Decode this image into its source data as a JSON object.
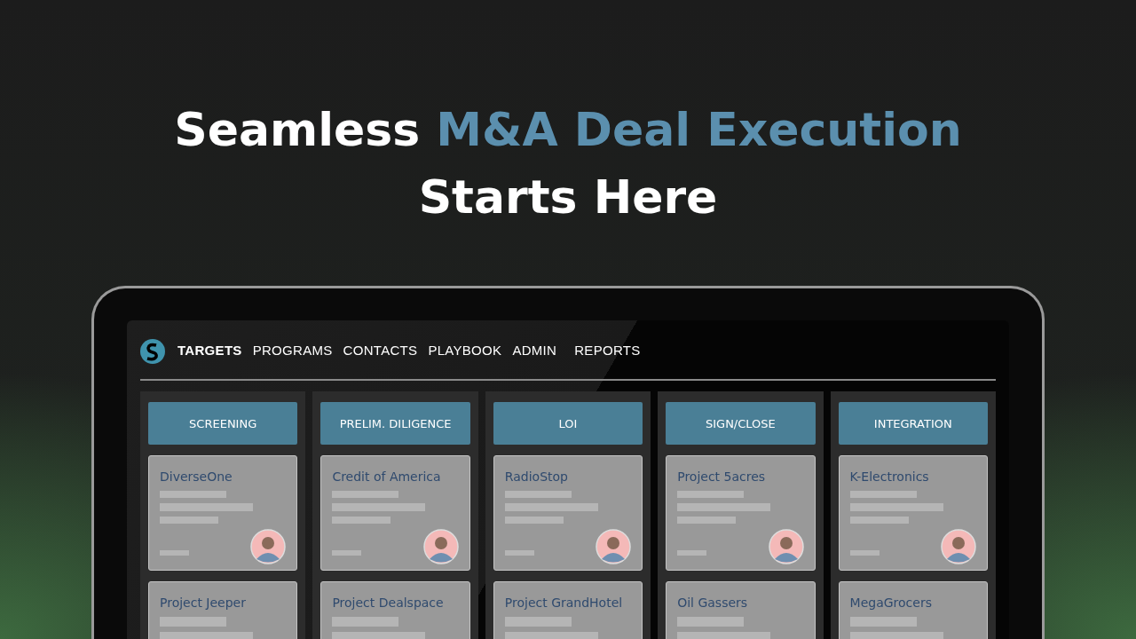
{
  "headline": {
    "line_1": [
      {
        "text": "Seamless ",
        "highlighted": false
      },
      {
        "text": "M&A Deal Execution",
        "highlighted": true
      }
    ],
    "line_2": "Starts Here"
  },
  "nav": [
    {
      "label": "TARGETS",
      "selected": true
    },
    {
      "label": "PROGRAMS",
      "selected": false
    },
    {
      "label": "CONTACTS",
      "selected": false
    },
    {
      "label": "PLAYBOOK",
      "selected": false
    },
    {
      "label": "ADMIN",
      "selected": false
    },
    {
      "label": "REPORTS",
      "selected": false
    }
  ],
  "columns": [
    {
      "title": "SCREENING",
      "cards": [
        {
          "name": "DiverseOne",
          "has_avatar": true
        },
        {
          "name": "Project Jeeper"
        }
      ]
    },
    {
      "title": "PRELIM. DILIGENCE",
      "cards": [
        {
          "name": "Credit of America",
          "has_avatar": true
        },
        {
          "name": "Project Dealspace"
        }
      ]
    },
    {
      "title": "LOI",
      "cards": [
        {
          "name": "RadioStop",
          "has_avatar": true
        },
        {
          "name": "Project GrandHotel"
        }
      ]
    },
    {
      "title": "SIGN/CLOSE",
      "cards": [
        {
          "name": "Project 5acres",
          "has_avatar": true
        },
        {
          "name": "Oil Gassers"
        }
      ]
    },
    {
      "title": "INTEGRATION",
      "cards": [
        {
          "name": "K-Electronics",
          "has_avatar": true
        },
        {
          "name": "MegaGrocers"
        }
      ]
    }
  ]
}
